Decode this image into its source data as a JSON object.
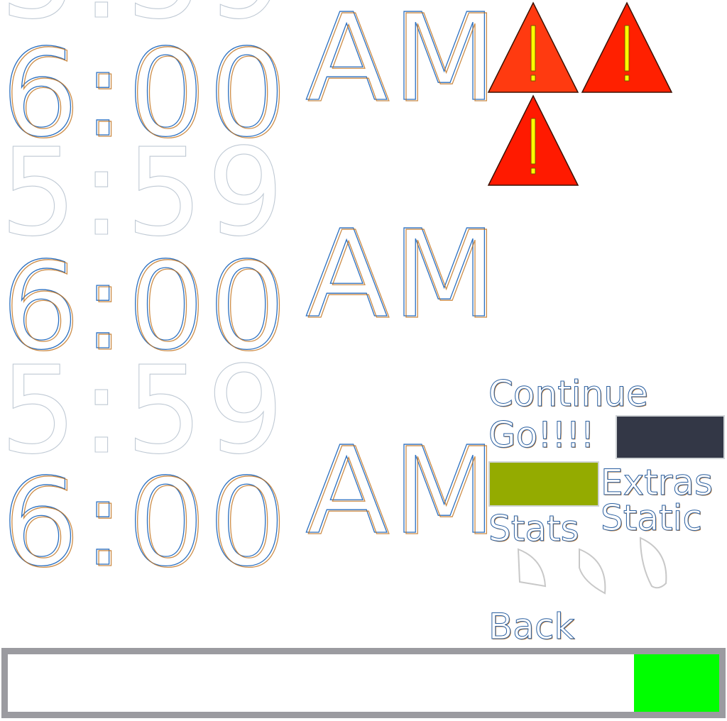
{
  "clocks": [
    {
      "time": "6:00",
      "meridiem": "AM"
    },
    {
      "time": "6:00",
      "meridiem": "AM"
    },
    {
      "time": "6:00",
      "meridiem": "AM"
    }
  ],
  "ghost_text": "5:59",
  "warning_icons": [
    "warning-triangle-icon",
    "warning-triangle-icon",
    "warning-triangle-icon"
  ],
  "menu": {
    "continue_label": "Continue",
    "go_label": "Go!!!!",
    "extras_label": "Extras",
    "stats_label": "Stats",
    "static_label": "Static",
    "back_label": "Back"
  },
  "colors": {
    "clock_stroke_a": "#2a6fc0",
    "clock_stroke_b": "#c0701a",
    "warning_fill": "#ff2000",
    "warning_mark": "#ffff00",
    "swatch_dark": "#333746",
    "swatch_olive": "#94ab00",
    "progress_fill": "#00ff00",
    "progress_border": "#9b9ba0"
  },
  "progress": {
    "fill_fraction": 0.12
  }
}
